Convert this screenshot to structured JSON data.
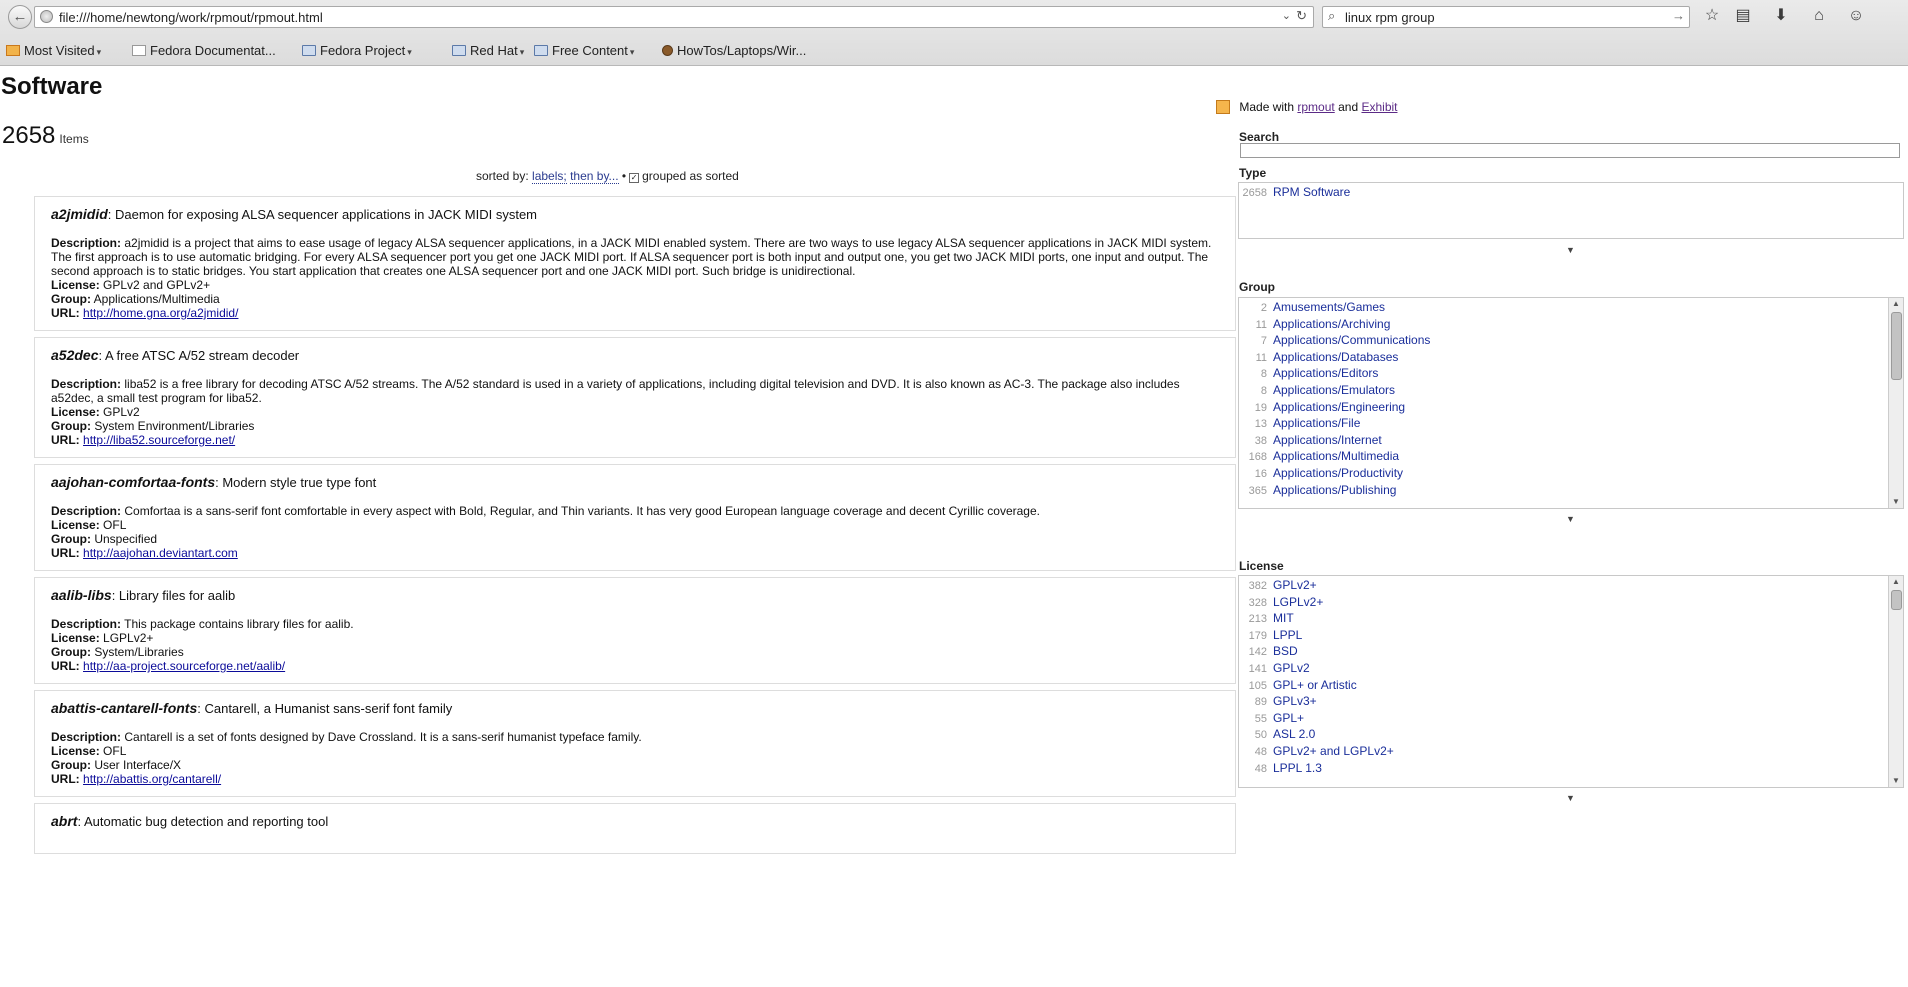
{
  "browser": {
    "url": "file:///home/newtong/work/rpmout/rpmout.html",
    "search_query": "linux rpm group",
    "bookmarks": [
      {
        "label": "Most Visited",
        "icon": "orange-feed-icon",
        "dropdown": true
      },
      {
        "label": "Fedora Documentat...",
        "icon": "page-icon",
        "dropdown": false
      },
      {
        "label": "Fedora Project",
        "icon": "folder-icon",
        "dropdown": true
      },
      {
        "label": "Red Hat",
        "icon": "folder-icon",
        "dropdown": true
      },
      {
        "label": "Free Content",
        "icon": "folder-icon",
        "dropdown": true
      },
      {
        "label": "HowTos/Laptops/Wir...",
        "icon": "gear-icon",
        "dropdown": false
      }
    ]
  },
  "page": {
    "title": "Software",
    "item_count": "2658",
    "items_word": "Items",
    "sort": {
      "prefix": "sorted by:",
      "labels_link": "labels;",
      "then_link": "then by...",
      "bullet": "•",
      "grouped_text": "grouped as sorted"
    },
    "field_labels": {
      "description": "Description:",
      "license": "License:",
      "group": "Group:",
      "url": "URL:"
    },
    "items": [
      {
        "name": "a2jmidid",
        "summary": ": Daemon for exposing ALSA sequencer applications in JACK MIDI system",
        "description": "a2jmidid is a project that aims to ease usage of legacy ALSA sequencer applications, in a JACK MIDI enabled system. There are two ways to use legacy ALSA sequencer applications in JACK MIDI system. The first approach is to use automatic bridging. For every ALSA sequencer port you get one JACK MIDI port. If ALSA sequencer port is both input and output one, you get two JACK MIDI ports, one input and output. The second approach is to static bridges. You start application that creates one ALSA sequencer port and one JACK MIDI port. Such bridge is unidirectional.",
        "license": "GPLv2 and GPLv2+",
        "group": "Applications/Multimedia",
        "url": "http://home.gna.org/a2jmidid/"
      },
      {
        "name": "a52dec",
        "summary": ": A free ATSC A/52 stream decoder",
        "description": "liba52 is a free library for decoding ATSC A/52 streams. The A/52 standard is used in a variety of applications, including digital television and DVD. It is also known as AC-3. The package also includes a52dec, a small test program for liba52.",
        "license": "GPLv2",
        "group": "System Environment/Libraries",
        "url": "http://liba52.sourceforge.net/"
      },
      {
        "name": "aajohan-comfortaa-fonts",
        "summary": ": Modern style true type font",
        "description": "Comfortaa is a sans-serif font comfortable in every aspect with Bold, Regular, and Thin variants. It has very good European language coverage and decent Cyrillic coverage.",
        "license": "OFL",
        "group": "Unspecified",
        "url": "http://aajohan.deviantart.com"
      },
      {
        "name": "aalib-libs",
        "summary": ": Library files for aalib",
        "description": "This package contains library files for aalib.",
        "license": "LGPLv2+",
        "group": "System/Libraries",
        "url": "http://aa-project.sourceforge.net/aalib/"
      },
      {
        "name": "abattis-cantarell-fonts",
        "summary": ": Cantarell, a Humanist sans-serif font family",
        "description": "Cantarell is a set of fonts designed by Dave Crossland. It is a sans-serif humanist typeface family.",
        "license": "OFL",
        "group": "User Interface/X",
        "url": "http://abattis.org/cantarell/"
      },
      {
        "name": "abrt",
        "summary": ": Automatic bug detection and reporting tool",
        "description": "",
        "license": "",
        "group": "",
        "url": ""
      }
    ]
  },
  "sidebar": {
    "made_with": "Made with",
    "rpmout_link": "rpmout",
    "and_word": "and",
    "exhibit_link": "Exhibit",
    "search_label": "Search",
    "type_label": "Type",
    "type_values": [
      {
        "count": "2658",
        "label": "RPM Software"
      }
    ],
    "group_label": "Group",
    "group_values": [
      {
        "count": "2",
        "label": "Amusements/Games"
      },
      {
        "count": "11",
        "label": "Applications/Archiving"
      },
      {
        "count": "7",
        "label": "Applications/Communications"
      },
      {
        "count": "11",
        "label": "Applications/Databases"
      },
      {
        "count": "8",
        "label": "Applications/Editors"
      },
      {
        "count": "8",
        "label": "Applications/Emulators"
      },
      {
        "count": "19",
        "label": "Applications/Engineering"
      },
      {
        "count": "13",
        "label": "Applications/File"
      },
      {
        "count": "38",
        "label": "Applications/Internet"
      },
      {
        "count": "168",
        "label": "Applications/Multimedia"
      },
      {
        "count": "16",
        "label": "Applications/Productivity"
      },
      {
        "count": "365",
        "label": "Applications/Publishing"
      }
    ],
    "license_label": "License",
    "license_values": [
      {
        "count": "382",
        "label": "GPLv2+"
      },
      {
        "count": "328",
        "label": "LGPLv2+"
      },
      {
        "count": "213",
        "label": "MIT"
      },
      {
        "count": "179",
        "label": "LPPL"
      },
      {
        "count": "142",
        "label": "BSD"
      },
      {
        "count": "141",
        "label": "GPLv2"
      },
      {
        "count": "105",
        "label": "GPL+ or Artistic"
      },
      {
        "count": "89",
        "label": "GPLv3+"
      },
      {
        "count": "55",
        "label": "GPL+"
      },
      {
        "count": "50",
        "label": "ASL 2.0"
      },
      {
        "count": "48",
        "label": "GPLv2+ and LGPLv2+"
      },
      {
        "count": "48",
        "label": "LPPL 1.3"
      }
    ]
  }
}
